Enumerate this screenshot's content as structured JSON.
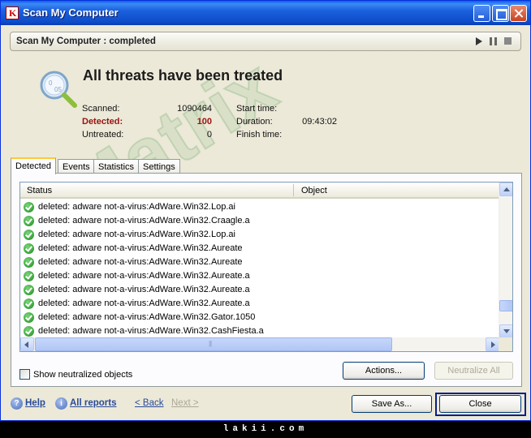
{
  "window": {
    "title": "Scan My Computer",
    "title_icon": "kaspersky-k-icon"
  },
  "status": {
    "text": "Scan My Computer : completed",
    "controls": [
      "play-icon",
      "pause-icon",
      "stop-icon"
    ]
  },
  "summary": {
    "headline": "All threats have been treated",
    "scanned_label": "Scanned:",
    "scanned_value": "1090464",
    "detected_label": "Detected:",
    "detected_value": "100",
    "untreated_label": "Untreated:",
    "untreated_value": "0",
    "start_time_label": "Start time:",
    "start_time_value": "",
    "duration_label": "Duration:",
    "duration_value": "09:43:02",
    "finish_time_label": "Finish time:",
    "finish_time_value": ""
  },
  "watermark": "Matrix",
  "tabs": [
    "Detected",
    "Events",
    "Statistics",
    "Settings"
  ],
  "active_tab": "Detected",
  "list": {
    "columns": [
      "Status",
      "Object"
    ],
    "rows": [
      "deleted: adware not-a-virus:AdWare.Win32.Lop.ai",
      "deleted: adware not-a-virus:AdWare.Win32.Craagle.a",
      "deleted: adware not-a-virus:AdWare.Win32.Lop.ai",
      "deleted: adware not-a-virus:AdWare.Win32.Aureate",
      "deleted: adware not-a-virus:AdWare.Win32.Aureate",
      "deleted: adware not-a-virus:AdWare.Win32.Aureate.a",
      "deleted: adware not-a-virus:AdWare.Win32.Aureate.a",
      "deleted: adware not-a-virus:AdWare.Win32.Aureate.a",
      "deleted: adware not-a-virus:AdWare.Win32.Gator.1050",
      "deleted: adware not-a-virus:AdWare.Win32.CashFiesta.a"
    ],
    "row_icon": "green-check-icon"
  },
  "options": {
    "show_neutralized_label": "Show neutralized objects",
    "show_neutralized_checked": false
  },
  "buttons": {
    "actions": "Actions...",
    "neutralize_all": "Neutralize All",
    "save_as": "Save As...",
    "close": "Close"
  },
  "links": {
    "help": "Help",
    "all_reports": "All reports",
    "back": "< Back",
    "next": "Next >"
  },
  "footer": "lakii.com",
  "colors": {
    "titlebar": "#1B61DE",
    "detected_red": "#9A1111",
    "link_blue": "#2A4A9A"
  }
}
